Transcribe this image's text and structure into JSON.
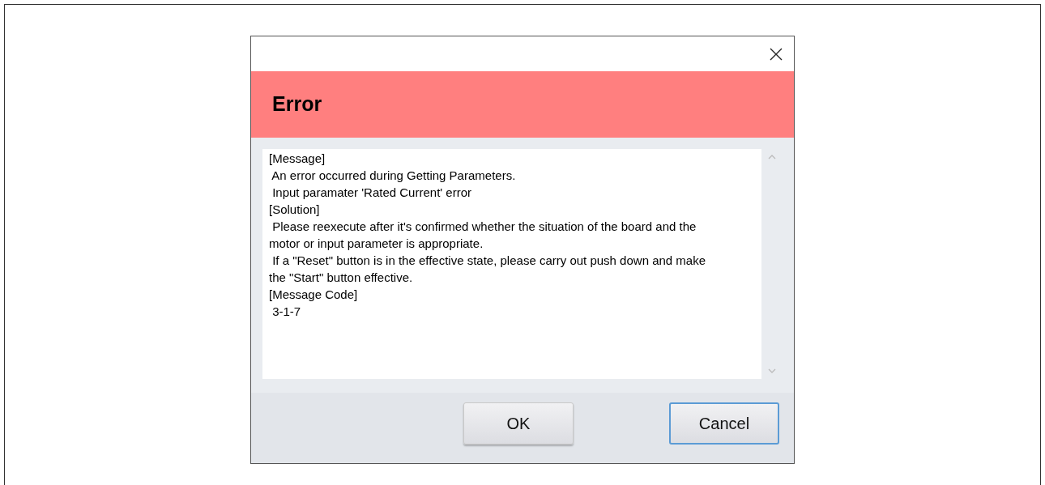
{
  "dialog": {
    "title": "Error",
    "message_lines": [
      "[Message]",
      " An error occurred during Getting Parameters.",
      " Input paramater 'Rated Current' error",
      "[Solution]",
      " Please reexecute after it's confirmed whether the situation of the board and the",
      "motor or input parameter is appropriate.",
      " If a \"Reset\" button is in the effective state, please carry out push down and make",
      "the \"Start\" button effective.",
      "[Message Code]",
      " 3-1-7"
    ],
    "buttons": [
      {
        "label": "OK",
        "focused": false
      },
      {
        "label": "Cancel",
        "focused": true
      }
    ]
  }
}
